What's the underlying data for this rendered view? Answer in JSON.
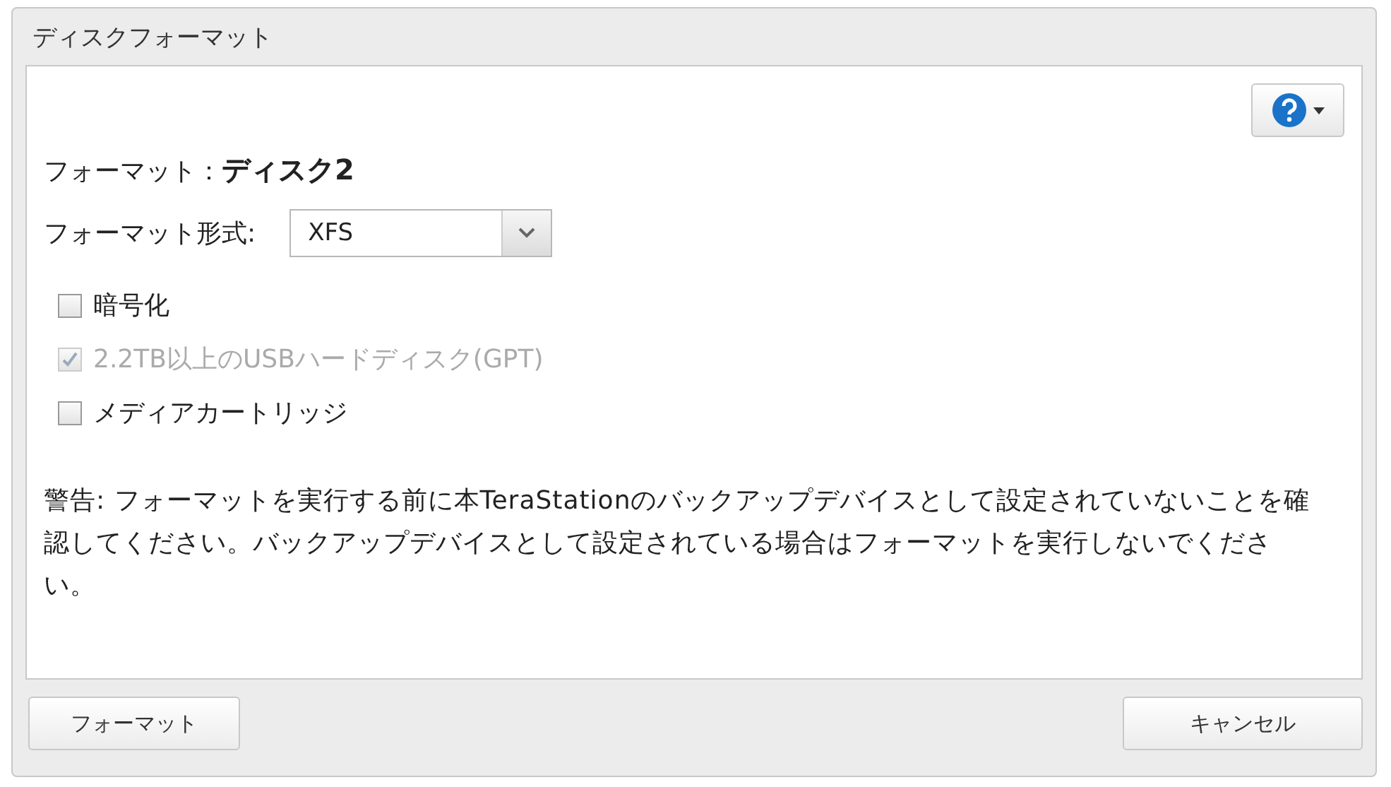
{
  "window": {
    "title": "ディスクフォーマット"
  },
  "target": "フォーマット：**ディスク2**",
  "format_type": {
    "label": "フォーマット形式:",
    "value": "XFS"
  },
  "options": [
    {
      "label": "暗号化",
      "checked": false,
      "disabled": false
    },
    {
      "label": "2.2TB以上のUSBハードディスク(GPT)",
      "checked": true,
      "disabled": true
    },
    {
      "label": "メディアカートリッジ",
      "checked": false,
      "disabled": false
    }
  ],
  "warning": "警告: フォーマットを実行する前に本TeraStationのバックアップデバイスとして設定されていないことを確認してください。バックアップデバイスとして設定されている場合はフォーマットを実行しないでください。",
  "buttons": [
    {
      "label": "フォーマット",
      "kind": "primary"
    },
    {
      "label": "キャンセル",
      "kind": "cancel"
    }
  ]
}
